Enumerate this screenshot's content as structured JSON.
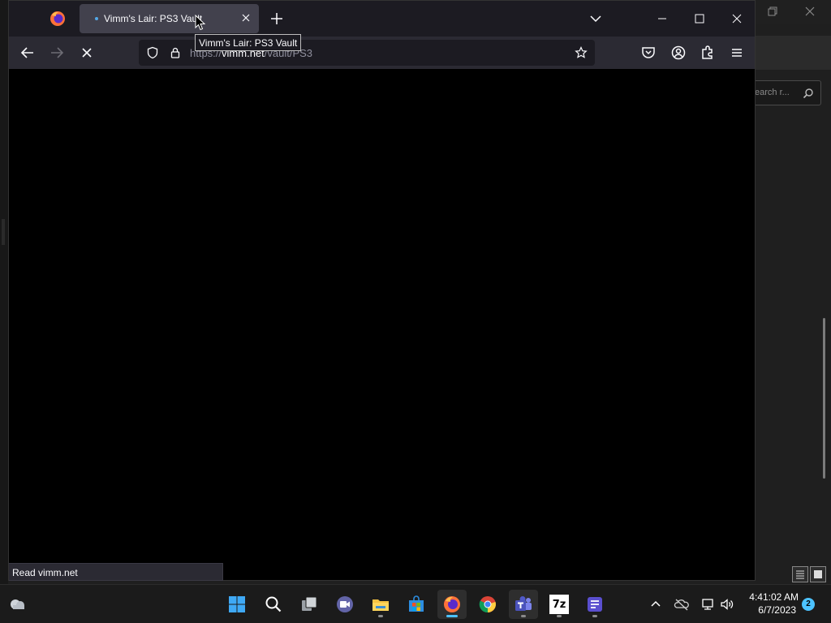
{
  "browser": {
    "tab": {
      "title": "Vimm's Lair: PS3 Vault"
    },
    "tooltip": "Vimm's Lair: PS3 Vault",
    "url": {
      "prefix": "https://",
      "host": "vimm.net",
      "path": "/vault/PS3"
    },
    "status": "Read vimm.net",
    "loading": true
  },
  "background_app": {
    "search_placeholder": "earch r..."
  },
  "taskbar": {
    "clock_time": "4:41:02 AM",
    "clock_date": "6/7/2023",
    "notification_count": "2",
    "apps": [
      "start-menu",
      "search",
      "task-view",
      "chat",
      "file-explorer",
      "microsoft-store",
      "firefox",
      "chrome",
      "teams",
      "7zip",
      "notepad"
    ],
    "seven_zip_label": "7z"
  },
  "colors": {
    "accent": "#4cc2ff",
    "tab_active": "#42414d",
    "toolbar": "#2b2a33",
    "urlbar": "#1c1b22"
  }
}
